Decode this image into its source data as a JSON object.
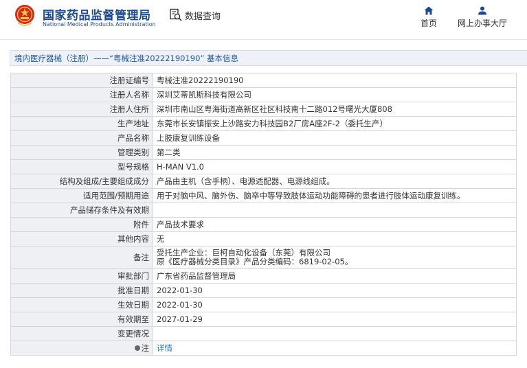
{
  "header": {
    "brand_cn": "国家药品监督管理局",
    "brand_en": "National Medical Products Administration",
    "data_query_label": "数据查询",
    "nav_home_label": "首页",
    "nav_online_label": "网上办事大厅",
    "accent_color": "#1a4a8d",
    "emblem_color": "#d8261c"
  },
  "title_bar": {
    "text": "境内医疗器械（注册）——“粤械注准20222190190” 基本信息"
  },
  "record": {
    "rows": [
      {
        "label": "注册证编号",
        "value": "粤械注准20222190190"
      },
      {
        "label": "注册人名称",
        "value": "深圳艾蒂凯斯科技有限公司"
      },
      {
        "label": "注册人住所",
        "value": "深圳市南山区粤海街道高新区社区科技南十二路012号曙光大厦808"
      },
      {
        "label": "生产地址",
        "value": "东莞市长安镇振安上沙路安力科技园B2厂房A座2F-2（委托生产）"
      },
      {
        "label": "产品名称",
        "value": "上肢康复训练设备"
      },
      {
        "label": "管理类别",
        "value": "第二类"
      },
      {
        "label": "型号规格",
        "value": "H-MAN V1.0"
      },
      {
        "label": "结构及组成/主要组成成分",
        "value": "产品由主机（含手柄）、电源适配器、电源线组成。"
      },
      {
        "label": "适用范围/预期用途",
        "value": "用于对脑中风、脑外伤、脑卒中等导致肢体运动功能障碍的患者进行肢体运动康复训练。"
      },
      {
        "label": "产品储存条件及有效期",
        "value": ""
      },
      {
        "label": "附件",
        "value": "产品技术要求"
      },
      {
        "label": "其他内容",
        "value": "无"
      }
    ],
    "remarks": {
      "label": "备注",
      "line1": "受托生产企业：巨柯自动化设备（东莞）有限公司",
      "line2": "原《医疗器械分类目录》产品分类编码：6819-02-05。"
    },
    "rows2": [
      {
        "label": "审批部门",
        "value": "广东省药品监督管理局"
      },
      {
        "label": "批准日期",
        "value": "2022-01-30"
      },
      {
        "label": "生效日期",
        "value": "2022-01-30"
      },
      {
        "label": "有效期至",
        "value": "2027-01-29"
      },
      {
        "label": "变更情况",
        "value": ""
      }
    ],
    "note": {
      "label": "注",
      "link": "详情"
    }
  }
}
